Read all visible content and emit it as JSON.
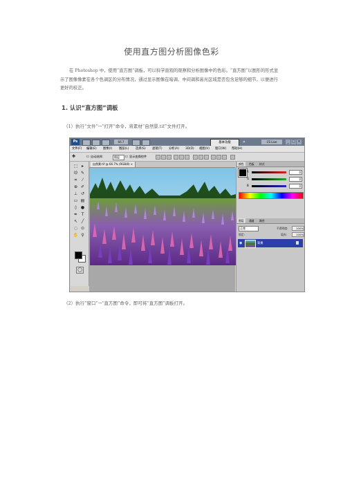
{
  "document": {
    "title": "使用直方图分析图像色彩",
    "intro": "在 Photoshop 中，使用“直方图”调板，可以科学直观的观察和分析图像中的色彩。“直方图”以图形的形式显示了图像像素在各个色调区的分布情况，通过显示图像在暗调、中间调和高光区域是否包含足够的细节，以便进行更好的校正。",
    "section_heading": "1. 认识“直方图”调板",
    "step1": "（1）执行“文件”→“打开”命令，将素材“自然景.tif”文件打开。",
    "step2": "（2）执行“窗口”→“直方图”命令，即可将“直方图”调板打开。"
  },
  "screenshot": {
    "app_logo": "Ps",
    "zoom": "66.7",
    "workspace_button": "基本功能",
    "more_chevron": "»",
    "cslive": "CS Live",
    "window_buttons": [
      "_",
      "□",
      "×"
    ],
    "menus": [
      "文件(F)",
      "编辑(E)",
      "图像(I)",
      "图层(L)",
      "选择(S)",
      "滤镜(T)",
      "分析(A)",
      "3D(D)",
      "视图(V)",
      "窗口(W)",
      "帮助(H)"
    ],
    "options": {
      "auto_select": "自动选择:",
      "auto_select_value": "图层",
      "show_transform": "显示变换控件"
    },
    "doc_tab": "自然景.tif @ 66.7% (RGB/8) ×",
    "color_panel": {
      "tabs": [
        "颜色",
        "色板",
        "样式"
      ],
      "channels": [
        {
          "label": "R",
          "value": "0",
          "color": "#d22"
        },
        {
          "label": "G",
          "value": "0",
          "color": "#2a2"
        },
        {
          "label": "B",
          "value": "0",
          "color": "#22c"
        }
      ]
    },
    "layers_panel": {
      "tabs": [
        "图层",
        "通道",
        "路径"
      ],
      "blend_mode": "正常",
      "opacity_label": "不透明度:",
      "opacity_value": "100%",
      "lock_label": "锁定:",
      "fill_label": "填充:",
      "fill_value": "100%",
      "layer_name": "背景"
    }
  }
}
